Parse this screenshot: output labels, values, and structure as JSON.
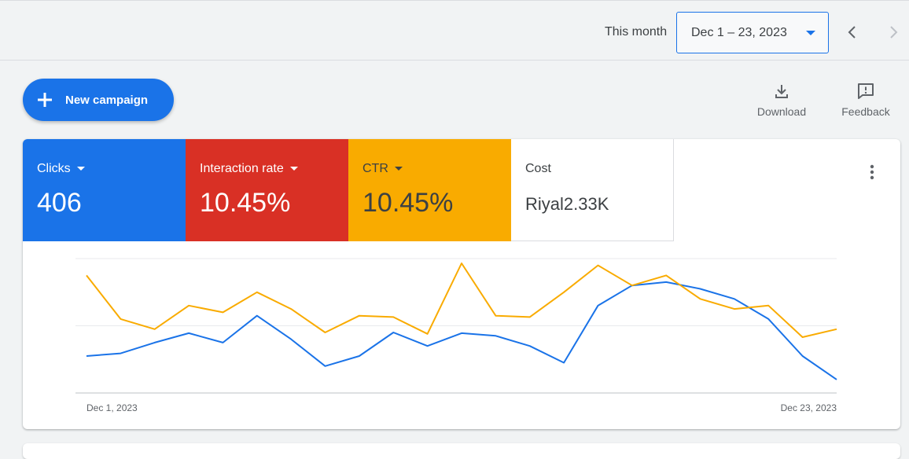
{
  "topbar": {
    "range_label": "This month",
    "date_range": "Dec 1 – 23, 2023"
  },
  "actions": {
    "new_campaign": "New campaign",
    "download": "Download",
    "feedback": "Feedback"
  },
  "metrics": [
    {
      "label": "Clicks",
      "value": "406",
      "color": "#1a73e8"
    },
    {
      "label": "Interaction rate",
      "value": "10.45%",
      "color": "#d93025"
    },
    {
      "label": "CTR",
      "value": "10.45%",
      "color": "#f9ab00"
    },
    {
      "label": "Cost",
      "value": "Riyal2.33K",
      "color": "#ffffff"
    }
  ],
  "chart_data": {
    "type": "line",
    "x": [
      "Dec 1",
      "Dec 2",
      "Dec 3",
      "Dec 4",
      "Dec 5",
      "Dec 6",
      "Dec 7",
      "Dec 8",
      "Dec 9",
      "Dec 10",
      "Dec 11",
      "Dec 12",
      "Dec 13",
      "Dec 14",
      "Dec 15",
      "Dec 16",
      "Dec 17",
      "Dec 18",
      "Dec 19",
      "Dec 20",
      "Dec 21",
      "Dec 22",
      "Dec 23"
    ],
    "x_tick_labels": [
      "Dec 1, 2023",
      "Dec 23, 2023"
    ],
    "series": [
      {
        "name": "Clicks",
        "color": "#1a73e8",
        "values": [
          0.55,
          0.59,
          0.75,
          0.89,
          0.75,
          1.15,
          0.8,
          0.4,
          0.55,
          0.9,
          0.7,
          0.89,
          0.85,
          0.7,
          0.45,
          1.3,
          1.6,
          1.65,
          1.55,
          1.4,
          1.1,
          0.55,
          0.2
        ]
      },
      {
        "name": "CTR",
        "color": "#f9ab00",
        "values": [
          1.75,
          1.1,
          0.95,
          1.3,
          1.2,
          1.5,
          1.25,
          0.9,
          1.15,
          1.13,
          0.88,
          1.93,
          1.15,
          1.13,
          1.5,
          1.9,
          1.6,
          1.75,
          1.4,
          1.25,
          1.3,
          0.83,
          0.95
        ]
      }
    ],
    "ylim": [
      0,
      2
    ],
    "grid": true,
    "legend": "none"
  }
}
